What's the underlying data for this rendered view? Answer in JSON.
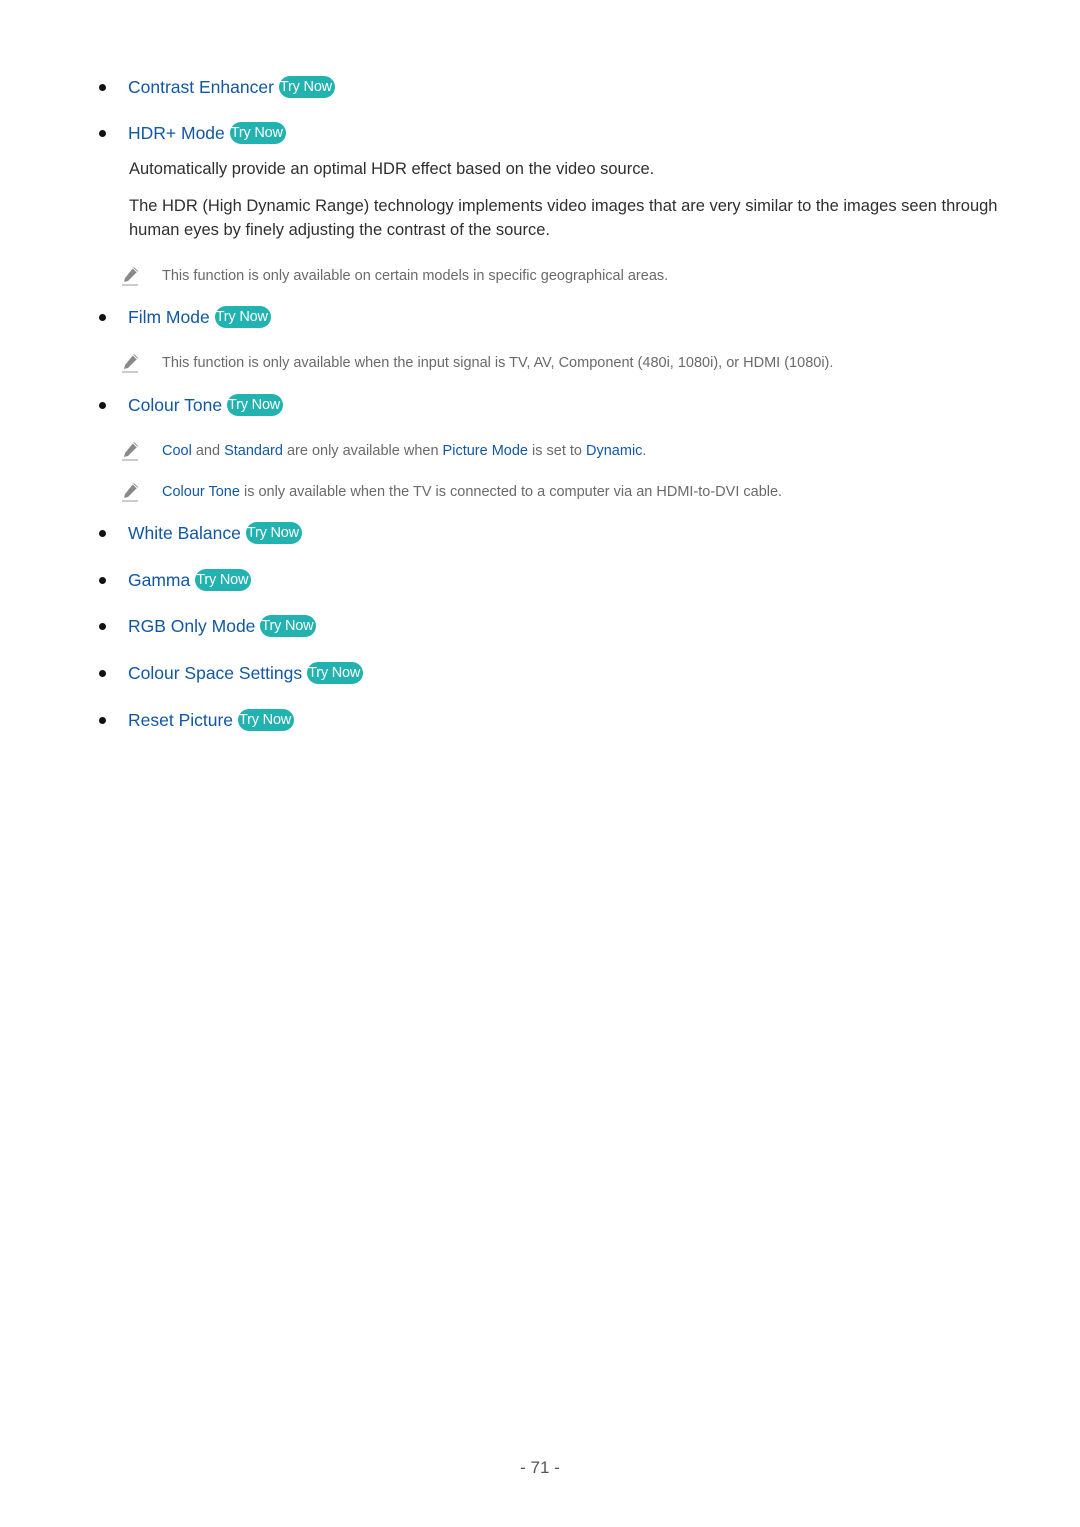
{
  "try_now_label": "Try Now",
  "colors": {
    "link": "#1257a6",
    "badge": "#22b2b0",
    "body_text": "#2f2f2f",
    "note_text": "#6a6a6a"
  },
  "items": [
    {
      "title": "Contrast Enhancer"
    },
    {
      "title": "HDR+ Mode"
    },
    {
      "title": "Film Mode"
    },
    {
      "title": "Colour Tone"
    },
    {
      "title": "White Balance"
    },
    {
      "title": "Gamma"
    },
    {
      "title": "RGB Only Mode"
    },
    {
      "title": "Colour Space Settings"
    },
    {
      "title": "Reset Picture"
    }
  ],
  "hdr_description": [
    "Automatically provide an optimal HDR effect based on the video source.",
    "The HDR (High Dynamic Range) technology implements video images that are very similar to the images seen through human eyes by finely adjusting the contrast of the source."
  ],
  "notes": {
    "hdr": "This function is only available on certain models in specific geographical areas.",
    "film_mode": "This function is only available when the input signal is TV, AV, Component (480i, 1080i), or HDMI (1080i).",
    "colour_tone_1": {
      "cool": "Cool",
      "and": " and ",
      "standard": "Standard",
      "are_only": " are only available when ",
      "picture_mode": "Picture Mode",
      "is_set_to": " is set to ",
      "dynamic": "Dynamic",
      "period": "."
    },
    "colour_tone_2": {
      "colour_tone": "Colour Tone",
      "rest": " is only available when the TV is connected to a computer via an HDMI-to-DVI cable."
    },
    "icon": "pencil-note-icon"
  },
  "page_number": "- 71 -"
}
